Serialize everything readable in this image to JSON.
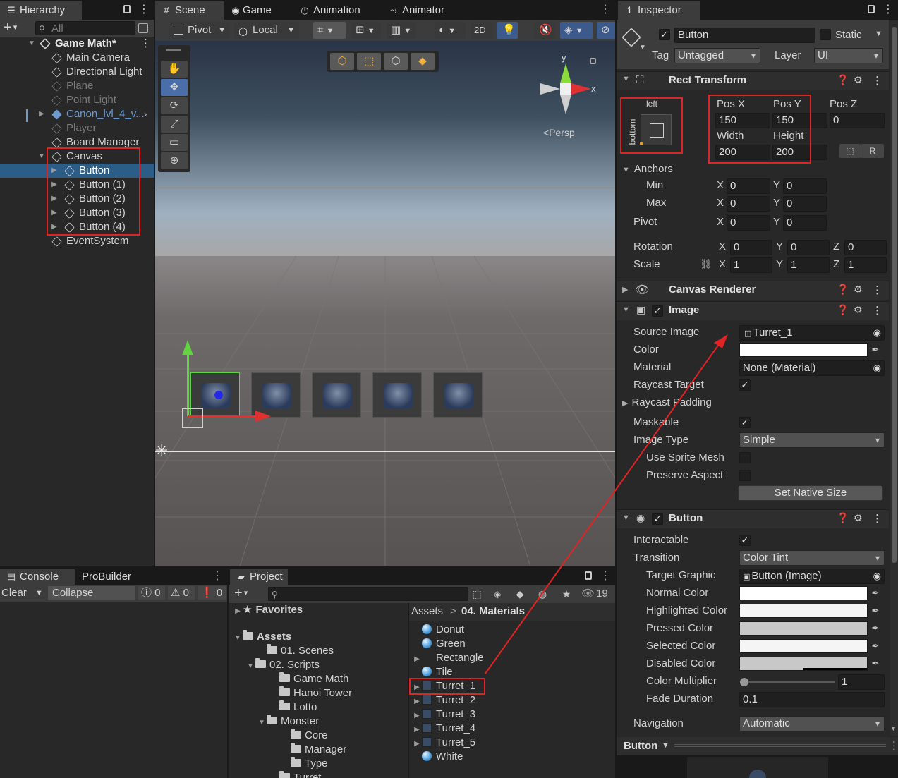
{
  "hierarchy": {
    "tab_label": "Hierarchy",
    "search_placeholder": "All",
    "add_label": "+",
    "scene_name": "Game Math*",
    "items": [
      {
        "label": "Main Camera",
        "state": "normal"
      },
      {
        "label": "Directional Light",
        "state": "normal"
      },
      {
        "label": "Plane",
        "state": "disabled"
      },
      {
        "label": "Point Light",
        "state": "disabled"
      },
      {
        "label": "Canon_lvl_4_v...",
        "state": "prefab"
      },
      {
        "label": "Player",
        "state": "disabled"
      },
      {
        "label": "Board Manager",
        "state": "normal"
      },
      {
        "label": "Canvas",
        "state": "normal"
      },
      {
        "label": "Button",
        "state": "selected"
      },
      {
        "label": "Button (1)",
        "state": "normal"
      },
      {
        "label": "Button (2)",
        "state": "normal"
      },
      {
        "label": "Button (3)",
        "state": "normal"
      },
      {
        "label": "Button (4)",
        "state": "normal"
      },
      {
        "label": "EventSystem",
        "state": "normal"
      }
    ]
  },
  "scene_view": {
    "tabs": [
      "Scene",
      "Game",
      "Animation",
      "Animator"
    ],
    "pivot_label": "Pivot",
    "local_label": "Local",
    "mode_2d_label": "2D",
    "persp_label": "<Persp",
    "gizmo_x": "x",
    "gizmo_y": "y"
  },
  "console": {
    "tabs": [
      "Console",
      "ProBuilder"
    ],
    "clear_label": "Clear",
    "collapse_label": "Collapse",
    "info_count": "0",
    "warning_count": "0",
    "error_count": "0"
  },
  "project": {
    "tab_label": "Project",
    "hidden_count": "19",
    "favorites_label": "Favorites",
    "tree": [
      {
        "label": "Assets",
        "bold": true
      },
      {
        "label": "01. Scenes"
      },
      {
        "label": "02. Scripts"
      },
      {
        "label": "Game Math"
      },
      {
        "label": "Hanoi Tower"
      },
      {
        "label": "Lotto"
      },
      {
        "label": "Monster"
      },
      {
        "label": "Core"
      },
      {
        "label": "Manager"
      },
      {
        "label": "Type"
      },
      {
        "label": "Turret"
      }
    ],
    "breadcrumb_root": "Assets",
    "breadcrumb_sep": ">",
    "breadcrumb_current": "04. Materials",
    "files": [
      {
        "label": "Donut",
        "kind": "material"
      },
      {
        "label": "Green",
        "kind": "material"
      },
      {
        "label": "Rectangle",
        "kind": "texture"
      },
      {
        "label": "Tile",
        "kind": "material"
      },
      {
        "label": "Turret_1",
        "kind": "sprite"
      },
      {
        "label": "Turret_2",
        "kind": "sprite"
      },
      {
        "label": "Turret_3",
        "kind": "sprite"
      },
      {
        "label": "Turret_4",
        "kind": "sprite"
      },
      {
        "label": "Turret_5",
        "kind": "sprite"
      },
      {
        "label": "White",
        "kind": "material"
      }
    ]
  },
  "inspector": {
    "tab_label": "Inspector",
    "object_name": "Button",
    "static_label": "Static",
    "tag_label": "Tag",
    "tag_value": "Untagged",
    "layer_label": "Layer",
    "layer_value": "UI",
    "rect_transform": {
      "title": "Rect Transform",
      "anchor_h": "left",
      "anchor_v": "bottom",
      "pos_x_label": "Pos X",
      "pos_x": "150",
      "pos_y_label": "Pos Y",
      "pos_y": "150",
      "pos_z_label": "Pos Z",
      "pos_z": "0",
      "width_label": "Width",
      "width": "200",
      "height_label": "Height",
      "height": "200",
      "anchors_label": "Anchors",
      "min_label": "Min",
      "max_label": "Max",
      "pivot_label": "Pivot",
      "min_x": "0",
      "min_y": "0",
      "max_x": "0",
      "max_y": "0",
      "pivot_x": "0",
      "pivot_y": "0",
      "rotation_label": "Rotation",
      "rot_x": "0",
      "rot_y": "0",
      "rot_z": "0",
      "scale_label": "Scale",
      "scale_x": "1",
      "scale_y": "1",
      "scale_z": "1",
      "axis_x": "X",
      "axis_y": "Y",
      "axis_z": "Z",
      "raw_btn": "R"
    },
    "canvas_renderer": {
      "title": "Canvas Renderer"
    },
    "image": {
      "title": "Image",
      "source_image_label": "Source Image",
      "source_image_value": "Turret_1",
      "color_label": "Color",
      "material_label": "Material",
      "material_value": "None (Material)",
      "raycast_target_label": "Raycast Target",
      "raycast_padding_label": "Raycast Padding",
      "maskable_label": "Maskable",
      "image_type_label": "Image Type",
      "image_type_value": "Simple",
      "use_sprite_mesh_label": "Use Sprite Mesh",
      "preserve_aspect_label": "Preserve Aspect",
      "set_native_size_label": "Set Native Size"
    },
    "button": {
      "title": "Button",
      "interactable_label": "Interactable",
      "transition_label": "Transition",
      "transition_value": "Color Tint",
      "target_graphic_label": "Target Graphic",
      "target_graphic_value": "Button (Image)",
      "normal_color_label": "Normal Color",
      "highlighted_color_label": "Highlighted Color",
      "pressed_color_label": "Pressed Color",
      "selected_color_label": "Selected Color",
      "disabled_color_label": "Disabled Color",
      "color_multiplier_label": "Color Multiplier",
      "color_multiplier_value": "1",
      "fade_duration_label": "Fade Duration",
      "fade_duration_value": "0.1",
      "navigation_label": "Navigation",
      "navigation_value": "Automatic"
    },
    "preview_label": "Button"
  },
  "colors": {
    "selection": "#2c5d87",
    "annotation_red": "#e02424",
    "panel_bg": "#282828",
    "prefab_blue": "#6c9bd2"
  }
}
